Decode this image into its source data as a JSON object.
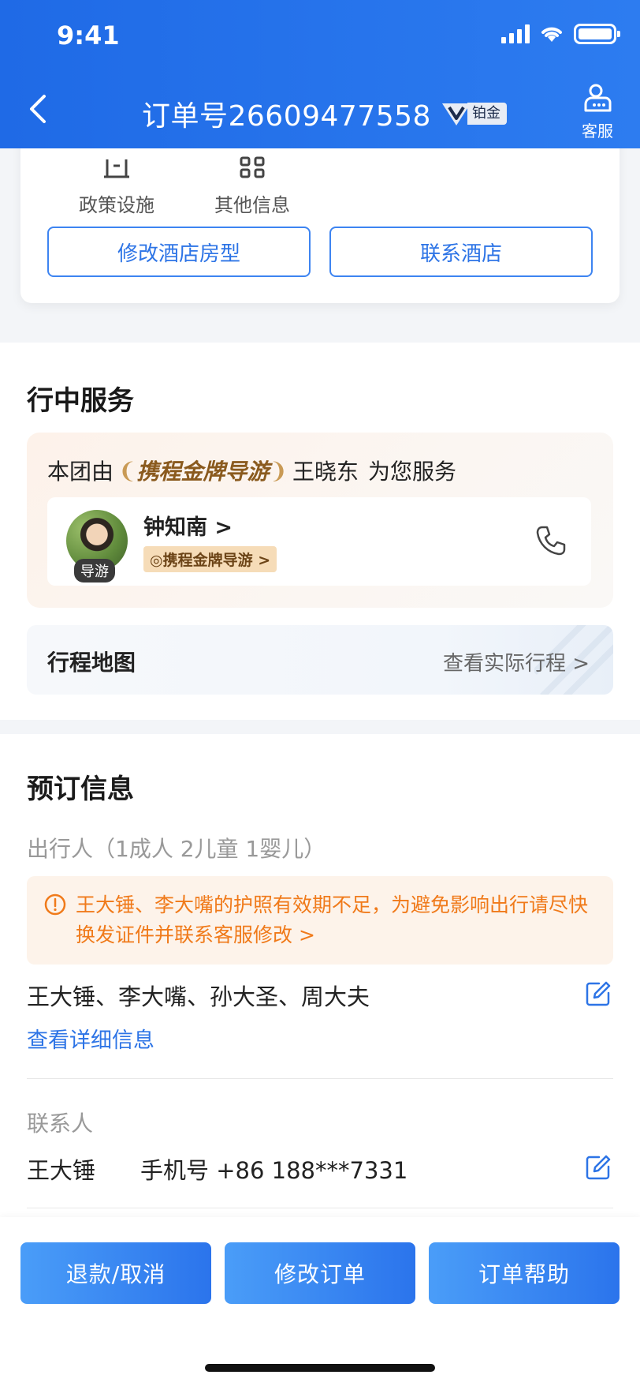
{
  "status_bar": {
    "time": "9:41"
  },
  "header": {
    "title": "订单号26609477558",
    "vip_label": "铂金",
    "service_label": "客服"
  },
  "hotel_card": {
    "tabs": [
      {
        "label": "政策设施",
        "icon": "building-icon"
      },
      {
        "label": "其他信息",
        "icon": "grid-icon"
      }
    ],
    "buttons": {
      "modify_room": "修改酒店房型",
      "contact_hotel": "联系酒店"
    }
  },
  "in_trip": {
    "title": "行中服务",
    "guide_intro_prefix": "本团由",
    "guide_brand": "携程金牌导游",
    "guide_intro_name": "王晓东",
    "guide_intro_suffix": "为您服务",
    "guide": {
      "name": "钟知南 >",
      "avatar_tag": "导游",
      "badge": "携程金牌导游 >"
    },
    "map": {
      "label": "行程地图",
      "link": "查看实际行程 >"
    }
  },
  "booking": {
    "title": "预订信息",
    "travelers_label": "出行人（1成人 2儿童 1婴儿）",
    "warning": "王大锤、李大嘴的护照有效期不足，为避免影响出行请尽快换发证件并联系客服修改 >",
    "travelers": "王大锤、李大嘴、孙大圣、周大夫",
    "detail_link": "查看详细信息",
    "contact_label": "联系人",
    "contact_name": "王大锤",
    "contact_phone": "手机号 +86 188***7331"
  },
  "bottom_actions": {
    "refund": "退款/取消",
    "modify": "修改订单",
    "help": "订单帮助"
  },
  "colors": {
    "header": "#2d7cf0",
    "accent": "#2d74e6",
    "warning": "#f07a1a",
    "gold": "#8a5a1e"
  }
}
